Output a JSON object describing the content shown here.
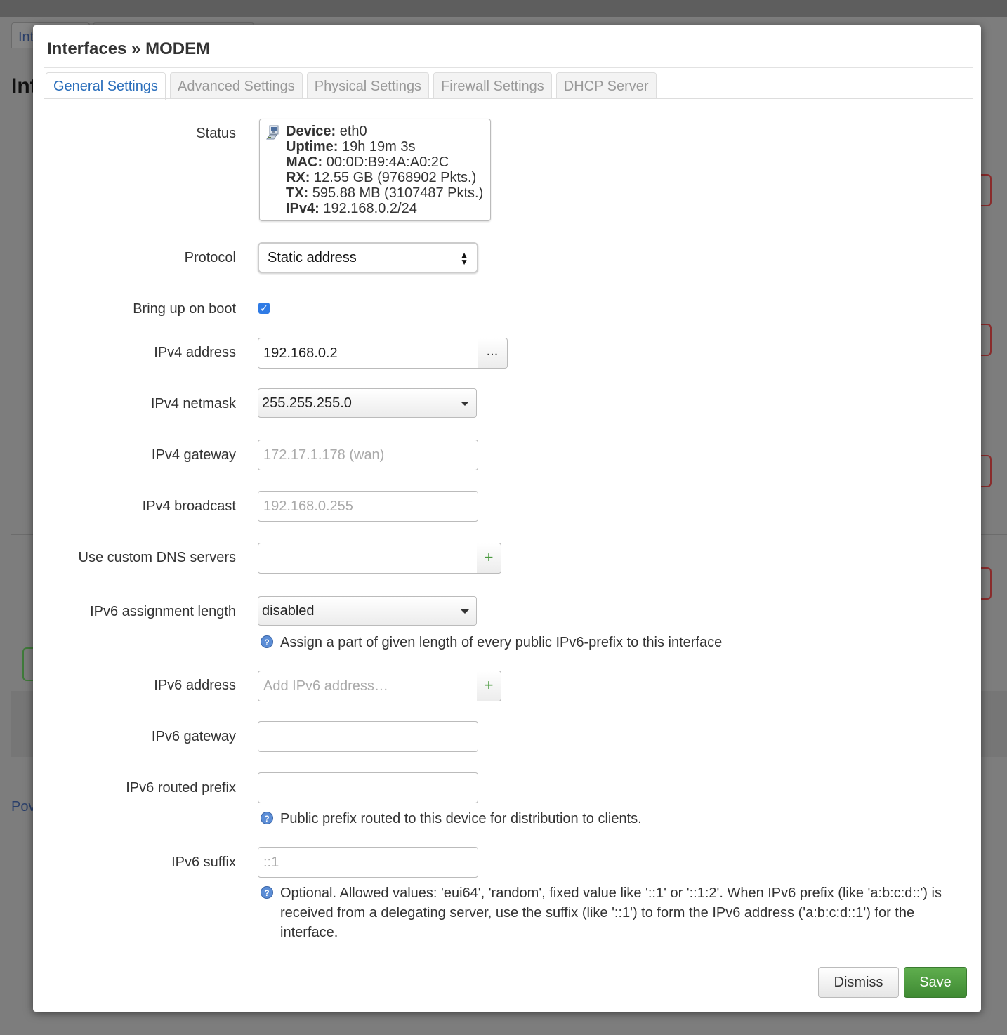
{
  "background": {
    "tab_text": "Int",
    "heading": "Int",
    "footer_text": "Pov"
  },
  "modal": {
    "title": "Interfaces » MODEM",
    "tabs": [
      {
        "label": "General Settings",
        "active": true
      },
      {
        "label": "Advanced Settings",
        "active": false
      },
      {
        "label": "Physical Settings",
        "active": false
      },
      {
        "label": "Firewall Settings",
        "active": false
      },
      {
        "label": "DHCP Server",
        "active": false
      }
    ]
  },
  "form": {
    "status": {
      "label": "Status",
      "icon": "ethernet-port-icon",
      "device_key": "Device:",
      "device_val": " eth0",
      "uptime_key": "Uptime:",
      "uptime_val": " 19h 19m 3s",
      "mac_key": "MAC:",
      "mac_val": " 00:0D:B9:4A:A0:2C",
      "rx_key": "RX:",
      "rx_val": " 12.55 GB (9768902 Pkts.)",
      "tx_key": "TX:",
      "tx_val": " 595.88 MB (3107487 Pkts.)",
      "ipv4_key": "IPv4:",
      "ipv4_val": " 192.168.0.2/24"
    },
    "protocol": {
      "label": "Protocol",
      "value": "Static address"
    },
    "bring_up": {
      "label": "Bring up on boot",
      "checked": true
    },
    "ipv4_address": {
      "label": "IPv4 address",
      "value": "192.168.0.2",
      "addon": "..."
    },
    "ipv4_netmask": {
      "label": "IPv4 netmask",
      "value": "255.255.255.0"
    },
    "ipv4_gateway": {
      "label": "IPv4 gateway",
      "placeholder": "172.17.1.178 (wan)"
    },
    "ipv4_broadcast": {
      "label": "IPv4 broadcast",
      "placeholder": "192.168.0.255"
    },
    "custom_dns": {
      "label": "Use custom DNS servers",
      "value": "",
      "addon": "+"
    },
    "ipv6_assign_len": {
      "label": "IPv6 assignment length",
      "value": "disabled",
      "help": "Assign a part of given length of every public IPv6-prefix to this interface"
    },
    "ipv6_address": {
      "label": "IPv6 address",
      "placeholder": "Add IPv6 address…",
      "addon": "+"
    },
    "ipv6_gateway": {
      "label": "IPv6 gateway",
      "value": ""
    },
    "ipv6_routed_prefix": {
      "label": "IPv6 routed prefix",
      "value": "",
      "help": "Public prefix routed to this device for distribution to clients."
    },
    "ipv6_suffix": {
      "label": "IPv6 suffix",
      "placeholder": "::1",
      "help_line1": "Optional. Allowed values: 'eui64', 'random', fixed value like '::1' or '::1:2'. When IPv6 prefix (like 'a:b:c:d::') is",
      "help_line2": "received from a delegating server, use the suffix (like '::1') to form the IPv6 address ('a:b:c:d::1') for the",
      "help_line3": "interface."
    }
  },
  "footer": {
    "dismiss_label": "Dismiss",
    "save_label": "Save"
  },
  "colors": {
    "accent": "#2a6ebb",
    "save": "#4a9a3f",
    "checkbox": "#2f7be5"
  }
}
